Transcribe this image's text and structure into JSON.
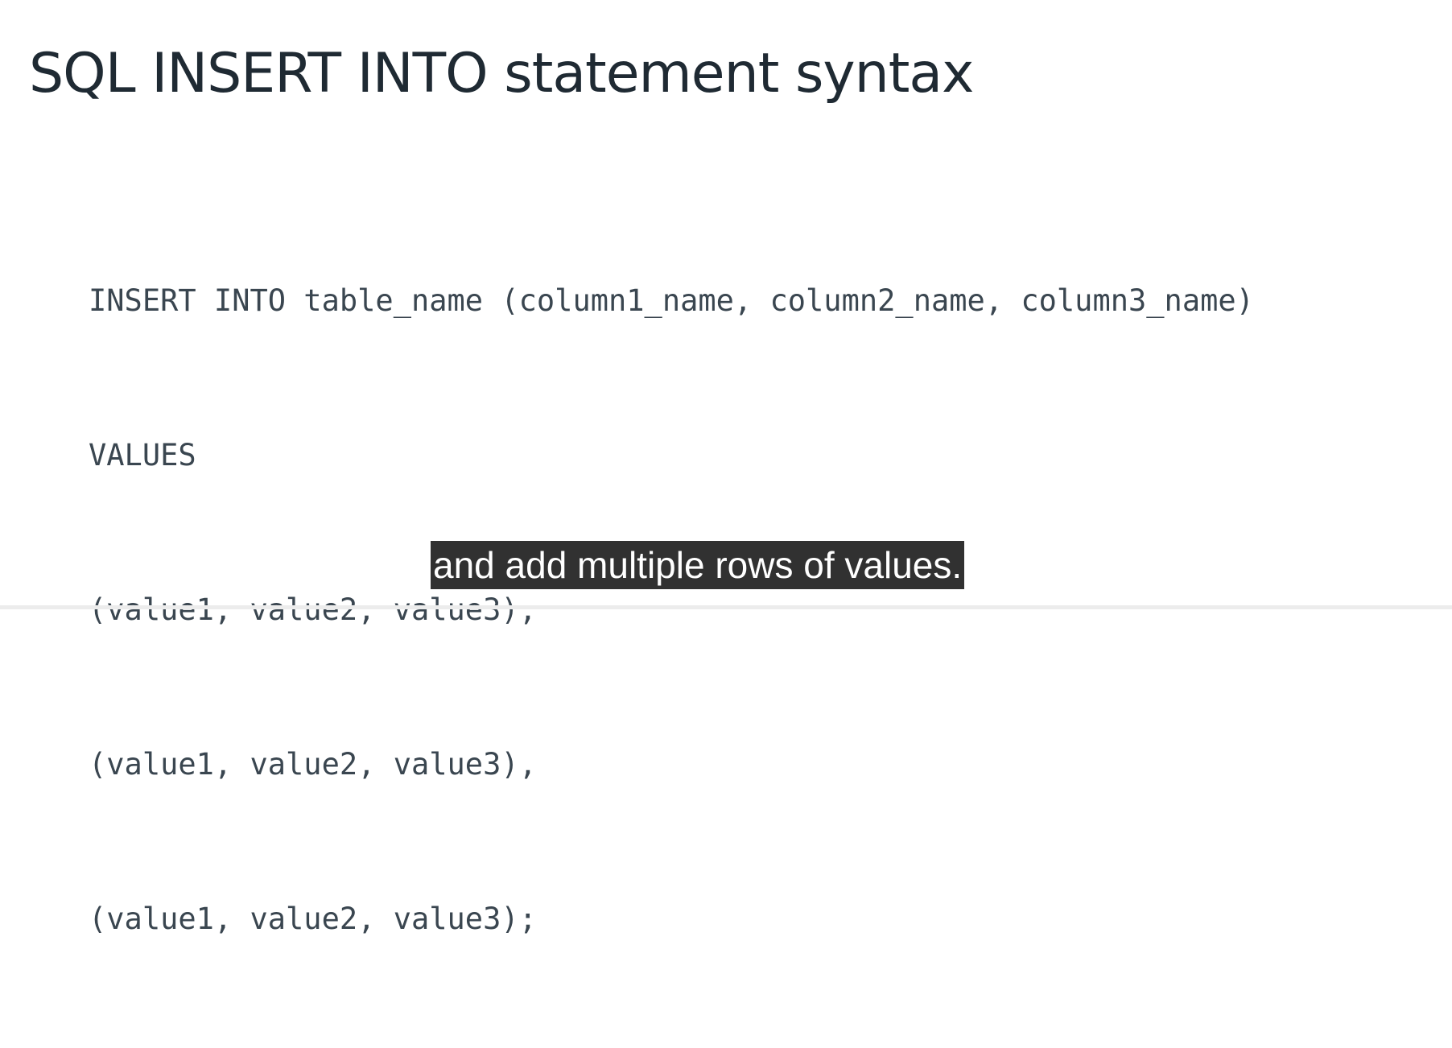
{
  "slide": {
    "title": "SQL INSERT INTO statement syntax",
    "code_lines": [
      "INSERT INTO table_name (column1_name, column2_name, column3_name)",
      "VALUES",
      "(value1, value2, value3),",
      "(value1, value2, value3),",
      "(value1, value2, value3);"
    ]
  },
  "caption": {
    "text": "and add multiple rows of values."
  }
}
